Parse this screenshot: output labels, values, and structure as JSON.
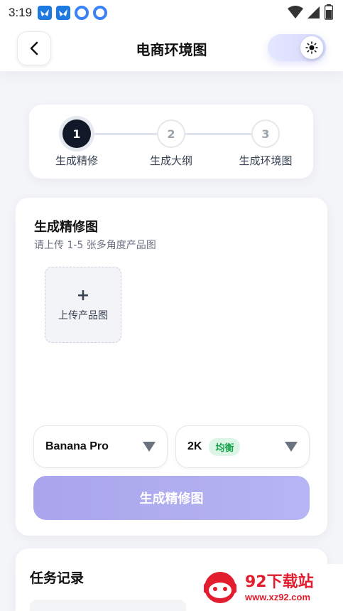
{
  "status_bar": {
    "time": "3:19"
  },
  "header": {
    "title": "电商环境图"
  },
  "steps": [
    {
      "number": "1",
      "label": "生成精修"
    },
    {
      "number": "2",
      "label": "生成大纲"
    },
    {
      "number": "3",
      "label": "生成环境图"
    }
  ],
  "refine": {
    "title": "生成精修图",
    "subtitle": "请上传 1-5 张多角度产品图",
    "upload_plus": "+",
    "upload_label": "上传产品图",
    "model_select": "Banana Pro",
    "resolution_select": "2K",
    "resolution_badge": "均衡",
    "submit_label": "生成精修图"
  },
  "tasks": {
    "title": "任务记录"
  },
  "watermark": {
    "name": "92下载站",
    "url": "www.xz92.com"
  },
  "colors": {
    "accent": "#a9a4ec",
    "dark": "#111827",
    "badge_green": "#16a34a",
    "watermark_red": "#e11d2e"
  }
}
